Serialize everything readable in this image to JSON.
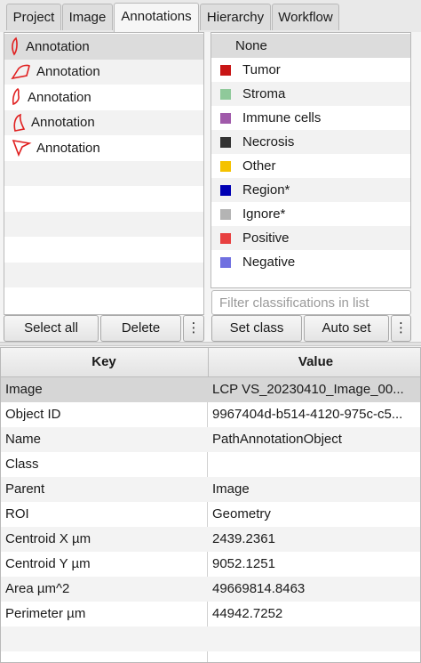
{
  "tabs": [
    {
      "label": "Project"
    },
    {
      "label": "Image"
    },
    {
      "label": "Annotations"
    },
    {
      "label": "Hierarchy"
    },
    {
      "label": "Workflow"
    }
  ],
  "active_tab": "Annotations",
  "annotations": {
    "items": [
      {
        "label": "Annotation",
        "icon": "annotation-shape-icon"
      },
      {
        "label": "Annotation",
        "icon": "annotation-shape-icon"
      },
      {
        "label": "Annotation",
        "icon": "annotation-shape-icon"
      },
      {
        "label": "Annotation",
        "icon": "annotation-shape-icon"
      },
      {
        "label": "Annotation",
        "icon": "annotation-shape-icon"
      }
    ],
    "select_all_label": "Select all",
    "delete_label": "Delete",
    "more_label": "⋮"
  },
  "classifications": {
    "none_label": "None",
    "items": [
      {
        "label": "Tumor",
        "color": "#c81616"
      },
      {
        "label": "Stroma",
        "color": "#8fc99a"
      },
      {
        "label": "Immune cells",
        "color": "#a05aaa"
      },
      {
        "label": "Necrosis",
        "color": "#333333"
      },
      {
        "label": "Other",
        "color": "#f5c200"
      },
      {
        "label": "Region*",
        "color": "#0000b4"
      },
      {
        "label": "Ignore*",
        "color": "#b4b4b4"
      },
      {
        "label": "Positive",
        "color": "#e84040"
      },
      {
        "label": "Negative",
        "color": "#7070e0"
      }
    ],
    "filter_placeholder": "Filter classifications in list",
    "set_class_label": "Set class",
    "auto_set_label": "Auto set",
    "more_label": "⋮"
  },
  "measurements": {
    "headers": {
      "key": "Key",
      "value": "Value"
    },
    "rows": [
      {
        "key": "Image",
        "value": "LCP VS_20230410_Image_00..."
      },
      {
        "key": "Object ID",
        "value": "9967404d-b514-4120-975c-c5..."
      },
      {
        "key": "Name",
        "value": "PathAnnotationObject"
      },
      {
        "key": "Class",
        "value": ""
      },
      {
        "key": "Parent",
        "value": "Image"
      },
      {
        "key": "ROI",
        "value": "Geometry"
      },
      {
        "key": "Centroid X µm",
        "value": "2439.2361"
      },
      {
        "key": "Centroid Y µm",
        "value": "9052.1251"
      },
      {
        "key": "Area µm^2",
        "value": "49669814.8463"
      },
      {
        "key": "Perimeter µm",
        "value": "44942.7252"
      }
    ]
  },
  "colors": {
    "annotation_stroke": "#e02020"
  }
}
